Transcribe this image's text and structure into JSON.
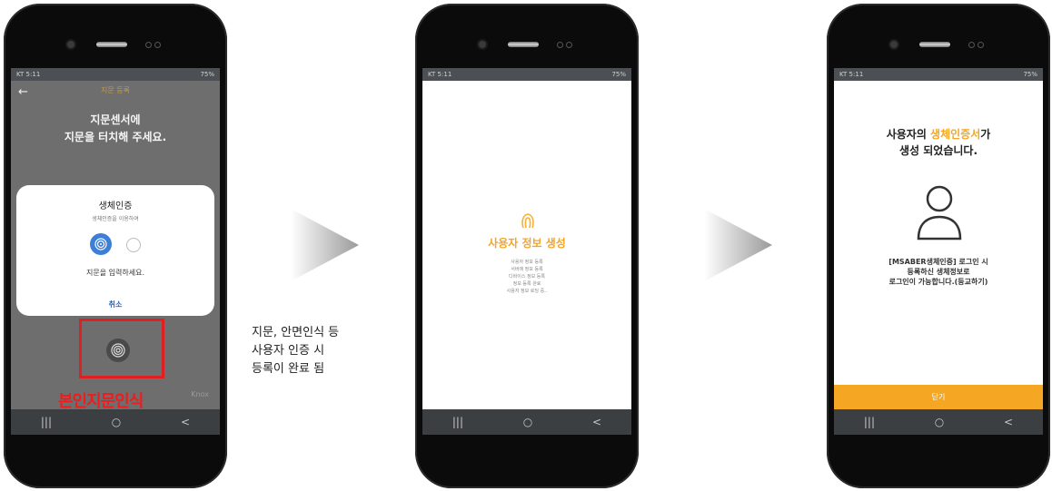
{
  "phones": [
    {
      "status_left": "KT 5:11",
      "status_right": "75%",
      "header_title": "지문 등록",
      "heading_line1": "지문센서에",
      "heading_line2": "지문을 터치해 주세요.",
      "dialog": {
        "title": "생체인증",
        "subtitle": "생체인증을 이용하여",
        "prompt": "지문을 입력하세요.",
        "cancel": "취소"
      },
      "highlight_label": "본인지문인식",
      "brand": "Knox"
    },
    {
      "status_left": "KT 5:11",
      "status_right": "75%",
      "title": "사용자 정보 생성",
      "steps": [
        "사용자 정보 등록",
        "서버에 정보 등록",
        "디바이스 정보 등록",
        "정보 등록 완료",
        "사용자 정보 로딩 중.."
      ]
    },
    {
      "status_left": "KT 5:11",
      "status_right": "75%",
      "msg_pre": "사용자의 ",
      "msg_highlight": "생체인증서",
      "msg_post": "가",
      "msg_line2": "생성 되었습니다.",
      "info_line1": "[MSABER생체인증] 로그인 시",
      "info_line2": "등록하신 생체정보로",
      "info_line3": "로그인이 가능합니다.(등교하기)",
      "close_button": "닫기"
    }
  ],
  "nav": {
    "recent": "|||",
    "home": "○",
    "back": "<"
  },
  "caption": [
    "지문, 안면인식 등",
    "사용자 인증 시",
    "등록이 완료 됨"
  ],
  "colors": {
    "accent": "#f5a623",
    "highlight_red": "#e02020",
    "blue": "#3d7fd8"
  }
}
